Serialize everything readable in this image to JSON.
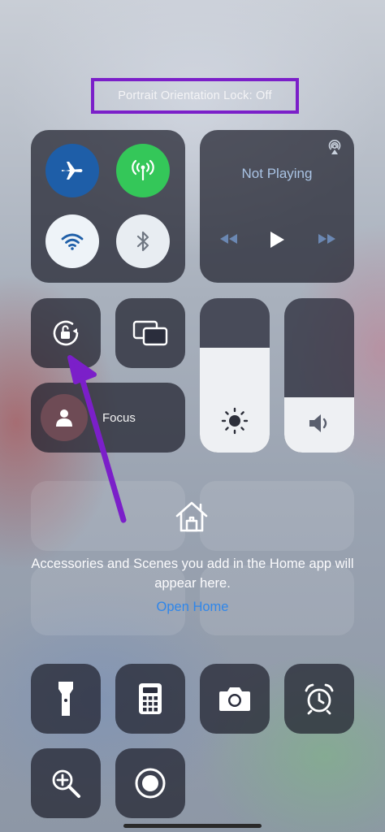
{
  "banner": {
    "text": "Portrait Orientation Lock: Off"
  },
  "connectivity": {
    "airplane": {
      "icon": "airplane-icon",
      "state": "off"
    },
    "cellular": {
      "icon": "cellular-antenna-icon",
      "state": "on",
      "color": "#34c759"
    },
    "wifi": {
      "icon": "wifi-icon",
      "state": "on"
    },
    "bluetooth": {
      "icon": "bluetooth-icon",
      "state": "on"
    }
  },
  "media": {
    "status": "Not Playing",
    "icons": [
      "airplay-icon",
      "rewind-icon",
      "play-icon",
      "fast-forward-icon"
    ]
  },
  "controls": {
    "orientation_lock": {
      "icon": "rotation-lock-icon",
      "state": "off"
    },
    "screen_mirroring": {
      "icon": "screen-mirroring-icon"
    },
    "brightness": {
      "icon": "sun-icon",
      "level": 0.68
    },
    "volume": {
      "icon": "speaker-icon",
      "level": 0.36
    }
  },
  "focus": {
    "label": "Focus",
    "icon": "person-icon"
  },
  "home": {
    "icon": "home-icon",
    "message": "Accessories and Scenes you add in the Home app will appear here.",
    "link": "Open Home",
    "link_color": "#2f86ea"
  },
  "bottom": [
    "flashlight-icon",
    "calculator-icon",
    "camera-icon",
    "alarm-clock-icon",
    "magnifier-icon",
    "screen-record-icon"
  ],
  "annotations": {
    "box_color": "#7b1fc9",
    "arrow_color": "#7b1fc9"
  }
}
